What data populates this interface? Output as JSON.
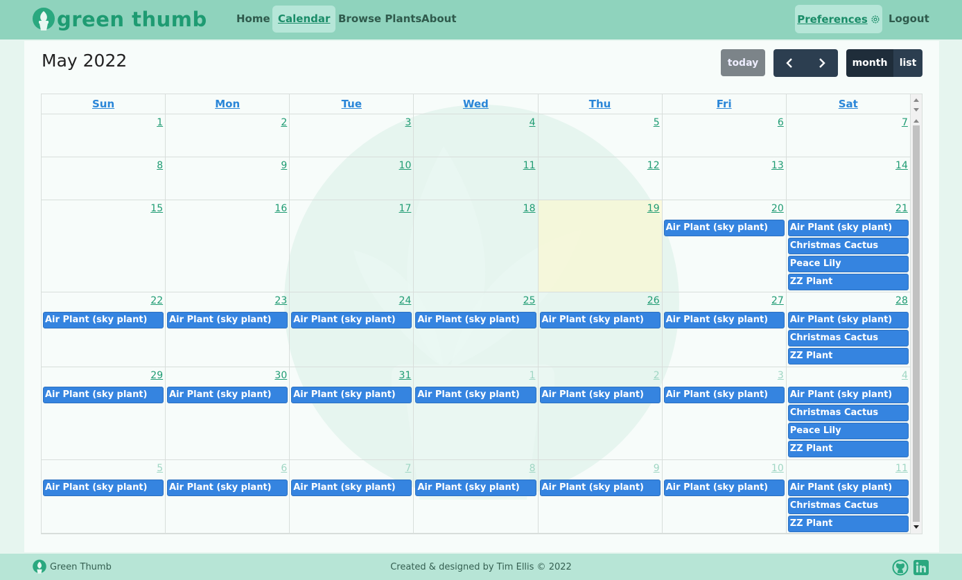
{
  "navbar": {
    "brand": "green thumb",
    "links": [
      "Home",
      "Calendar",
      "Browse Plants",
      "About"
    ],
    "active": "Calendar",
    "preferences": "Preferences",
    "logout": "Logout"
  },
  "calendar": {
    "title": "May 2022",
    "today_button": "today",
    "prev_icon": "chevron-left-icon",
    "next_icon": "chevron-right-icon",
    "view_month": "month",
    "view_list": "list",
    "weekdays": [
      "Sun",
      "Mon",
      "Tue",
      "Wed",
      "Thu",
      "Fri",
      "Sat"
    ],
    "weeks": [
      [
        {
          "num": "1",
          "other": false,
          "events": []
        },
        {
          "num": "2",
          "other": false,
          "events": []
        },
        {
          "num": "3",
          "other": false,
          "events": []
        },
        {
          "num": "4",
          "other": false,
          "events": []
        },
        {
          "num": "5",
          "other": false,
          "events": []
        },
        {
          "num": "6",
          "other": false,
          "events": []
        },
        {
          "num": "7",
          "other": false,
          "events": []
        }
      ],
      [
        {
          "num": "8",
          "other": false,
          "events": []
        },
        {
          "num": "9",
          "other": false,
          "events": []
        },
        {
          "num": "10",
          "other": false,
          "events": []
        },
        {
          "num": "11",
          "other": false,
          "events": []
        },
        {
          "num": "12",
          "other": false,
          "events": []
        },
        {
          "num": "13",
          "other": false,
          "events": []
        },
        {
          "num": "14",
          "other": false,
          "events": []
        }
      ],
      [
        {
          "num": "15",
          "other": false,
          "events": []
        },
        {
          "num": "16",
          "other": false,
          "events": []
        },
        {
          "num": "17",
          "other": false,
          "events": []
        },
        {
          "num": "18",
          "other": false,
          "events": []
        },
        {
          "num": "19",
          "other": false,
          "today": true,
          "events": []
        },
        {
          "num": "20",
          "other": false,
          "events": [
            "Air Plant (sky plant)"
          ]
        },
        {
          "num": "21",
          "other": false,
          "events": [
            "Air Plant (sky plant)",
            "Christmas Cactus",
            "Peace Lily",
            "ZZ Plant"
          ]
        }
      ],
      [
        {
          "num": "22",
          "other": false,
          "events": [
            "Air Plant (sky plant)"
          ]
        },
        {
          "num": "23",
          "other": false,
          "events": [
            "Air Plant (sky plant)"
          ]
        },
        {
          "num": "24",
          "other": false,
          "events": [
            "Air Plant (sky plant)"
          ]
        },
        {
          "num": "25",
          "other": false,
          "events": [
            "Air Plant (sky plant)"
          ]
        },
        {
          "num": "26",
          "other": false,
          "events": [
            "Air Plant (sky plant)"
          ]
        },
        {
          "num": "27",
          "other": false,
          "events": [
            "Air Plant (sky plant)"
          ]
        },
        {
          "num": "28",
          "other": false,
          "events": [
            "Air Plant (sky plant)",
            "Christmas Cactus",
            "ZZ Plant"
          ]
        }
      ],
      [
        {
          "num": "29",
          "other": false,
          "events": [
            "Air Plant (sky plant)"
          ]
        },
        {
          "num": "30",
          "other": false,
          "events": [
            "Air Plant (sky plant)"
          ]
        },
        {
          "num": "31",
          "other": false,
          "events": [
            "Air Plant (sky plant)"
          ]
        },
        {
          "num": "1",
          "other": true,
          "events": [
            "Air Plant (sky plant)"
          ]
        },
        {
          "num": "2",
          "other": true,
          "events": [
            "Air Plant (sky plant)"
          ]
        },
        {
          "num": "3",
          "other": true,
          "events": [
            "Air Plant (sky plant)"
          ]
        },
        {
          "num": "4",
          "other": true,
          "events": [
            "Air Plant (sky plant)",
            "Christmas Cactus",
            "Peace Lily",
            "ZZ Plant"
          ]
        }
      ],
      [
        {
          "num": "5",
          "other": true,
          "events": [
            "Air Plant (sky plant)"
          ]
        },
        {
          "num": "6",
          "other": true,
          "events": [
            "Air Plant (sky plant)"
          ]
        },
        {
          "num": "7",
          "other": true,
          "events": [
            "Air Plant (sky plant)"
          ]
        },
        {
          "num": "8",
          "other": true,
          "events": [
            "Air Plant (sky plant)"
          ]
        },
        {
          "num": "9",
          "other": true,
          "events": [
            "Air Plant (sky plant)"
          ]
        },
        {
          "num": "10",
          "other": true,
          "events": [
            "Air Plant (sky plant)"
          ]
        },
        {
          "num": "11",
          "other": true,
          "events": [
            "Air Plant (sky plant)",
            "Christmas Cactus",
            "ZZ Plant"
          ]
        }
      ]
    ]
  },
  "footer": {
    "brand": "Green Thumb",
    "credit": "Created & designed by Tim Ellis © 2022",
    "icons": [
      "github-icon",
      "linkedin-icon"
    ]
  },
  "colors": {
    "navbar": "#8fd3bd",
    "brand": "#1e9b72",
    "event": "#3584e0",
    "today": "#fff7c8"
  }
}
